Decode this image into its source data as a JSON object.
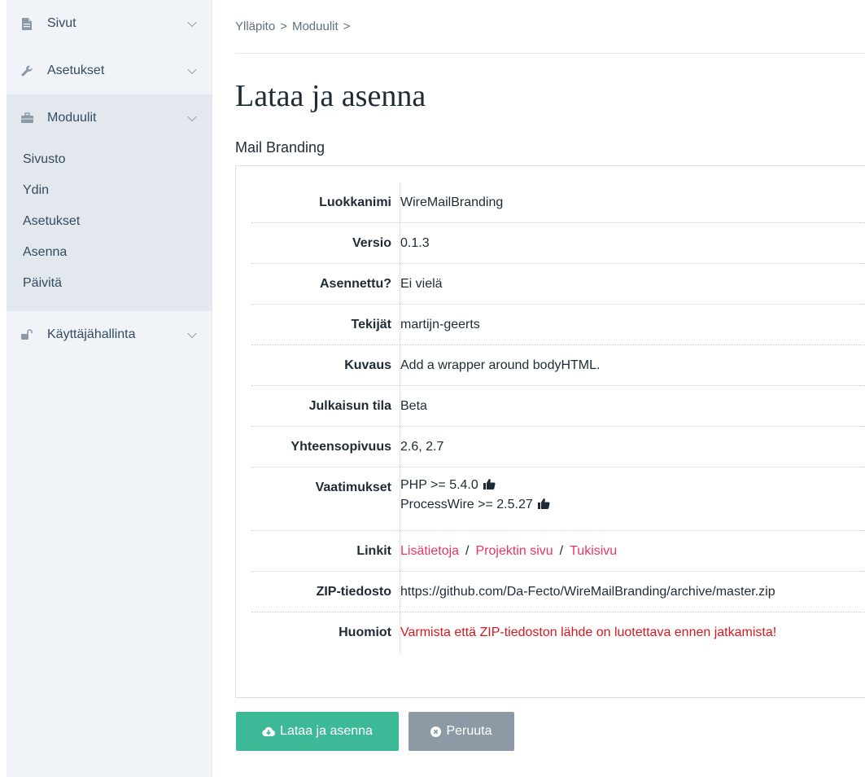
{
  "sidebar": {
    "items": [
      {
        "label": "Sivut",
        "icon": "file-icon"
      },
      {
        "label": "Asetukset",
        "icon": "wrench-icon"
      },
      {
        "label": "Moduulit",
        "icon": "briefcase-icon"
      }
    ],
    "modules_sub": [
      "Sivusto",
      "Ydin",
      "Asetukset",
      "Asenna",
      "Päivitä"
    ],
    "users": {
      "label": "Käyttäjähallinta",
      "icon": "unlock-icon"
    }
  },
  "breadcrumb": [
    "Ylläpito",
    ">",
    "Moduulit",
    ">"
  ],
  "page": {
    "title": "Lataa ja asenna",
    "module_name": "Mail Branding"
  },
  "details": {
    "class_label": "Luokkanimi",
    "class_value": "WireMailBranding",
    "version_label": "Versio",
    "version_value": "0.1.3",
    "installed_label": "Asennettu?",
    "installed_value": "Ei vielä",
    "authors_label": "Tekijät",
    "authors_value": "martijn-geerts",
    "desc_label": "Kuvaus",
    "desc_value": "Add a wrapper around bodyHTML.",
    "state_label": "Julkaisun tila",
    "state_value": "Beta",
    "compat_label": "Yhteensopivuus",
    "compat_value": "2.6, 2.7",
    "req_label": "Vaatimukset",
    "req_php": "PHP >= 5.4.0",
    "req_pw": "ProcessWire >= 2.5.27",
    "links_label": "Linkit",
    "link_more": "Lisätietoja",
    "link_sep": "/",
    "link_project": "Projektin sivu",
    "link_support": "Tukisivu",
    "zip_label": "ZIP-tiedosto",
    "zip_value": "https://github.com/Da-Fecto/WireMailBranding/archive/master.zip",
    "notes_label": "Huomiot",
    "notes_value": "Varmista että ZIP-tiedoston lähde on luotettava ennen jatkamista!"
  },
  "buttons": {
    "install": "Lataa ja asenna",
    "cancel": "Peruuta"
  },
  "colors": {
    "accent": "#3eb998",
    "link": "#e83561",
    "warning": "#d6191f",
    "cancel": "#8d9aa6"
  }
}
